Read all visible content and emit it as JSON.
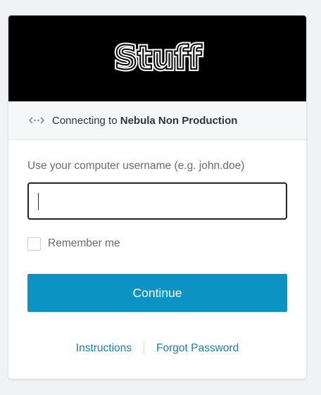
{
  "brand": {
    "logo_text": "Stuff"
  },
  "connection": {
    "prefix": "Connecting to ",
    "environment": "Nebula Non Production",
    "icon": "connect-arrows-icon"
  },
  "form": {
    "username_label": "Use your computer username (e.g. john.doe)",
    "username_value": "",
    "remember_label": "Remember me",
    "remember_checked": false,
    "continue_label": "Continue"
  },
  "links": {
    "instructions": "Instructions",
    "forgot_password": "Forgot Password"
  },
  "colors": {
    "primary": "#0a93c3",
    "link": "#1b7db0",
    "banner": "#000000"
  }
}
